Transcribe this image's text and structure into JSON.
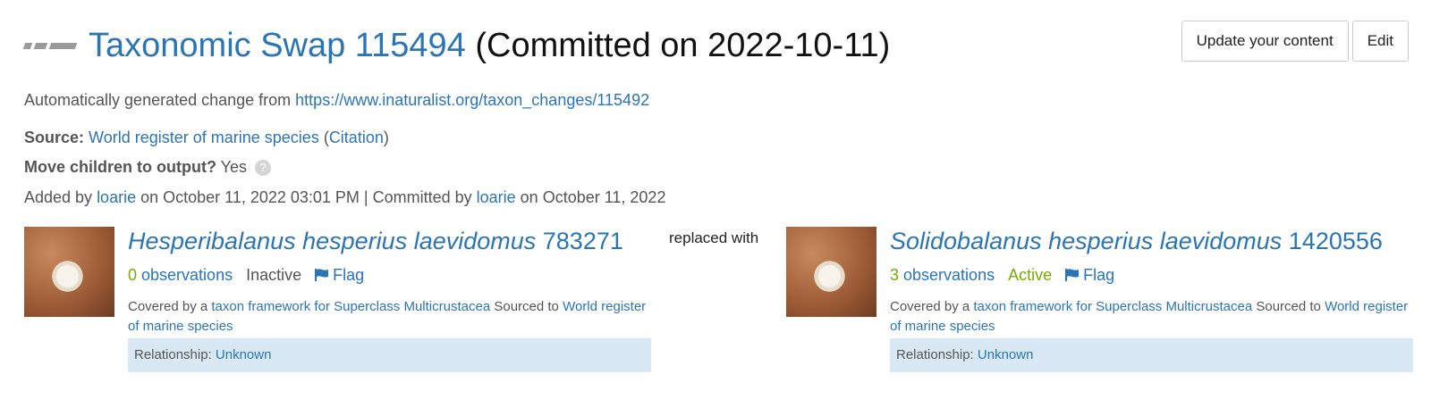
{
  "header": {
    "title_link": "Taxonomic Swap 115494",
    "title_rest": " (Committed on 2022-10-11)",
    "update_button": "Update your content",
    "edit_button": "Edit"
  },
  "auto": {
    "text": "Automatically generated change from ",
    "url": "https://www.inaturalist.org/taxon_changes/115492"
  },
  "source": {
    "label": "Source:",
    "name": "World register of marine species",
    "open": " (",
    "citation": "Citation",
    "close": ")"
  },
  "move_children": {
    "label": "Move children to output?",
    "value": "Yes",
    "help": "?"
  },
  "added": {
    "prefix": "Added by ",
    "user1": "loarie",
    "mid": " on October 11, 2022 03:01 PM | Committed by ",
    "user2": "loarie",
    "suffix": " on October 11, 2022"
  },
  "replaced_with": "replaced with",
  "input_taxon": {
    "name": "Hesperibalanus hesperius laevidomus",
    "id": " 783271",
    "obs_count": "0",
    "obs_label": " observations",
    "status": "Inactive",
    "flag": "Flag",
    "covered_prefix": "Covered by a ",
    "framework": "taxon framework for Superclass Multicrustacea",
    "sourced": " Sourced to ",
    "source_name": "World register of marine species",
    "rel_label": "Relationship: ",
    "rel_value": "Unknown"
  },
  "output_taxon": {
    "name": "Solidobalanus hesperius laevidomus",
    "id": " 1420556",
    "obs_count": "3",
    "obs_label": " observations",
    "status": "Active",
    "flag": "Flag",
    "covered_prefix": "Covered by a ",
    "framework": "taxon framework for Superclass Multicrustacea",
    "sourced": " Sourced to ",
    "source_name": "World register of marine species",
    "rel_label": "Relationship: ",
    "rel_value": "Unknown"
  },
  "colors": {
    "link": "#2b75b5",
    "active": "#74ac00",
    "relationship_bg": "#d8e9f5"
  }
}
